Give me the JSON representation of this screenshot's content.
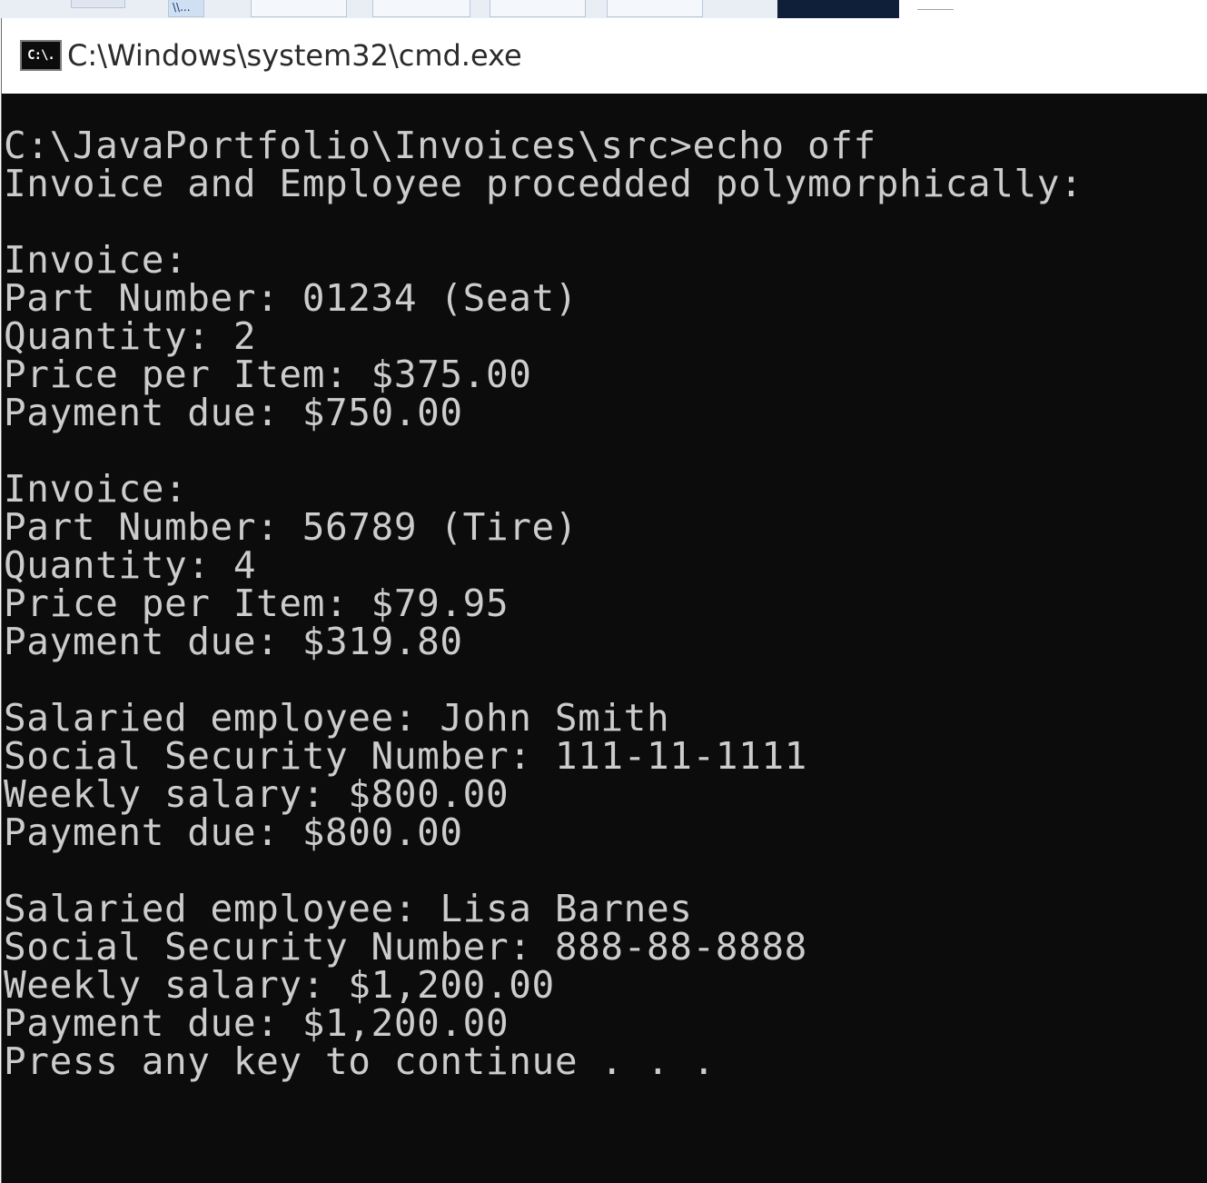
{
  "background_taskbar": {
    "tab_label": "\\\\..."
  },
  "window": {
    "title": "C:\\Windows\\system32\\cmd.exe",
    "icon_label": "C:\\."
  },
  "console": {
    "lines": [
      "C:\\JavaPortfolio\\Invoices\\src>echo off",
      "Invoice and Employee procedded polymorphically:",
      "",
      "Invoice:",
      "Part Number: 01234 (Seat)",
      "Quantity: 2",
      "Price per Item: $375.00",
      "Payment due: $750.00",
      "",
      "Invoice:",
      "Part Number: 56789 (Tire)",
      "Quantity: 4",
      "Price per Item: $79.95",
      "Payment due: $319.80",
      "",
      "Salaried employee: John Smith",
      "Social Security Number: 111-11-1111",
      "Weekly salary: $800.00",
      "Payment due: $800.00",
      "",
      "Salaried employee: Lisa Barnes",
      "Social Security Number: 888-88-8888",
      "Weekly salary: $1,200.00",
      "Payment due: $1,200.00",
      "Press any key to continue . . ."
    ]
  },
  "colors": {
    "console_bg": "#0c0c0c",
    "console_fg": "#cccccc",
    "titlebar_bg": "#ffffff"
  }
}
